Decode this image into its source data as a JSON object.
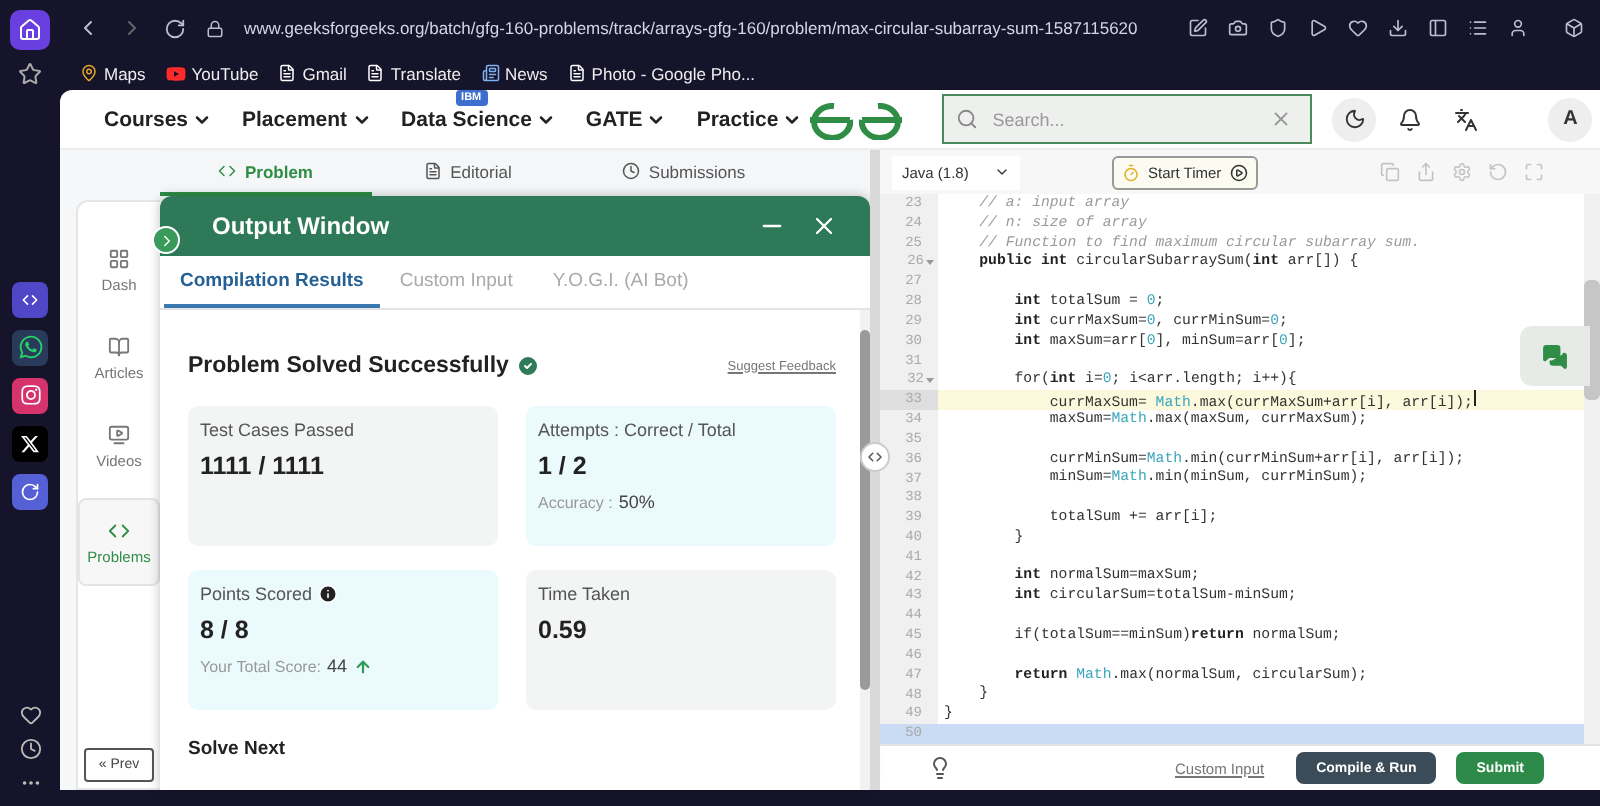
{
  "browser": {
    "url": "www.geeksforgeeks.org/batch/gfg-160-problems/track/arrays-gfg-160/problem/max-circular-subarray-sum-1587115620"
  },
  "bookmarks": [
    {
      "label": "Maps"
    },
    {
      "label": "YouTube"
    },
    {
      "label": "Gmail"
    },
    {
      "label": "Translate"
    },
    {
      "label": "News"
    },
    {
      "label": "Photo - Google Pho..."
    }
  ],
  "nav": {
    "items": [
      {
        "label": "Courses"
      },
      {
        "label": "Placement"
      },
      {
        "label": "Data Science",
        "badge": "IBM"
      },
      {
        "label": "GATE"
      },
      {
        "label": "Practice"
      }
    ]
  },
  "search": {
    "placeholder": "Search..."
  },
  "avatar": "A",
  "problem_tabs": [
    {
      "label": "Problem",
      "selected": true
    },
    {
      "label": "Editorial",
      "selected": false
    },
    {
      "label": "Submissions",
      "selected": false
    }
  ],
  "side_nav": [
    {
      "label": "Dash",
      "selected": false
    },
    {
      "label": "Articles",
      "selected": false
    },
    {
      "label": "Videos",
      "selected": false
    },
    {
      "label": "Problems",
      "selected": true
    }
  ],
  "prev_button": "« Prev",
  "output_window": {
    "title": "Output Window",
    "tabs": [
      {
        "label": "Compilation Results",
        "selected": true
      },
      {
        "label": "Custom Input",
        "selected": false
      },
      {
        "label": "Y.O.G.I. (AI Bot)",
        "selected": false
      }
    ],
    "status": "Problem Solved Successfully",
    "feedback_link": "Suggest Feedback",
    "cards": [
      {
        "label": "Test Cases Passed",
        "value": "1111 / 1111",
        "info": false
      },
      {
        "label": "Attempts : Correct / Total",
        "value": "1 / 2",
        "note_label": "Accuracy :",
        "note_value": "50%",
        "info": false,
        "rising": false
      },
      {
        "label": "Points Scored",
        "value": "8 / 8",
        "note_label": "Your Total Score:",
        "note_value": "44",
        "info": true,
        "rising": true
      },
      {
        "label": "Time Taken",
        "value": "0.59",
        "info": false
      }
    ],
    "solve_next": "Solve Next"
  },
  "editor": {
    "language": "Java (1.8)",
    "timer_button": "Start Timer",
    "lines": [
      {
        "n": "23",
        "fold": false,
        "current": false,
        "selected": false,
        "tokens": [
          {
            "kind": "comment",
            "t": "    // a: input array"
          }
        ]
      },
      {
        "n": "24",
        "fold": false,
        "current": false,
        "selected": false,
        "tokens": [
          {
            "kind": "comment",
            "t": "    // n: size of array"
          }
        ]
      },
      {
        "n": "25",
        "fold": false,
        "current": false,
        "selected": false,
        "tokens": [
          {
            "kind": "comment",
            "t": "    // Function to find maximum circular subarray sum."
          }
        ]
      },
      {
        "n": "26",
        "fold": true,
        "current": false,
        "selected": false,
        "tokens": [
          {
            "kind": "keyword",
            "t": "    public int"
          },
          {
            "kind": "plain",
            "t": " circularSubarraySum("
          },
          {
            "kind": "keyword",
            "t": "int"
          },
          {
            "kind": "plain",
            "t": " arr[]) {"
          }
        ]
      },
      {
        "n": "27",
        "fold": false,
        "current": false,
        "selected": false
      },
      {
        "n": "28",
        "fold": false,
        "current": false,
        "selected": false,
        "tokens": [
          {
            "kind": "keyword",
            "t": "        int"
          },
          {
            "kind": "plain",
            "t": " totalSum = "
          },
          {
            "kind": "number",
            "t": "0"
          },
          {
            "kind": "plain",
            "t": ";"
          }
        ]
      },
      {
        "n": "29",
        "fold": false,
        "current": false,
        "selected": false,
        "tokens": [
          {
            "kind": "keyword",
            "t": "        int"
          },
          {
            "kind": "plain",
            "t": " currMaxSum="
          },
          {
            "kind": "number",
            "t": "0"
          },
          {
            "kind": "plain",
            "t": ", currMinSum="
          },
          {
            "kind": "number",
            "t": "0"
          },
          {
            "kind": "plain",
            "t": ";"
          }
        ]
      },
      {
        "n": "30",
        "fold": false,
        "current": false,
        "selected": false,
        "tokens": [
          {
            "kind": "keyword",
            "t": "        int"
          },
          {
            "kind": "plain",
            "t": " maxSum=arr["
          },
          {
            "kind": "number",
            "t": "0"
          },
          {
            "kind": "plain",
            "t": "], minSum=arr["
          },
          {
            "kind": "number",
            "t": "0"
          },
          {
            "kind": "plain",
            "t": "];"
          }
        ]
      },
      {
        "n": "31",
        "fold": false,
        "current": false,
        "selected": false
      },
      {
        "n": "32",
        "fold": true,
        "current": false,
        "selected": false,
        "tokens": [
          {
            "kind": "plain",
            "t": "        for("
          },
          {
            "kind": "keyword",
            "t": "int"
          },
          {
            "kind": "plain",
            "t": " i="
          },
          {
            "kind": "number",
            "t": "0"
          },
          {
            "kind": "plain",
            "t": "; i<arr.length; i++){"
          }
        ]
      },
      {
        "n": "33",
        "fold": false,
        "current": true,
        "selected": false,
        "tokens": [
          {
            "kind": "plain",
            "t": "            currMaxSum= "
          },
          {
            "kind": "builtin",
            "t": "Math"
          },
          {
            "kind": "plain",
            "t": ".max(currMaxSum+arr[i], arr[i]);"
          }
        ]
      },
      {
        "n": "34",
        "fold": false,
        "current": false,
        "selected": false,
        "tokens": [
          {
            "kind": "plain",
            "t": "            maxSum="
          },
          {
            "kind": "builtin",
            "t": "Math"
          },
          {
            "kind": "plain",
            "t": ".max(maxSum, currMaxSum);"
          }
        ]
      },
      {
        "n": "35",
        "fold": false,
        "current": false,
        "selected": false
      },
      {
        "n": "36",
        "fold": false,
        "current": false,
        "selected": false,
        "tokens": [
          {
            "kind": "plain",
            "t": "            currMinSum="
          },
          {
            "kind": "builtin",
            "t": "Math"
          },
          {
            "kind": "plain",
            "t": ".min(currMinSum+arr[i], arr[i]);"
          }
        ]
      },
      {
        "n": "37",
        "fold": false,
        "current": false,
        "selected": false,
        "tokens": [
          {
            "kind": "plain",
            "t": "            minSum="
          },
          {
            "kind": "builtin",
            "t": "Math"
          },
          {
            "kind": "plain",
            "t": ".min(minSum, currMinSum);"
          }
        ]
      },
      {
        "n": "38",
        "fold": false,
        "current": false,
        "selected": false
      },
      {
        "n": "39",
        "fold": false,
        "current": false,
        "selected": false,
        "tokens": [
          {
            "kind": "plain",
            "t": "            totalSum += arr[i];"
          }
        ]
      },
      {
        "n": "40",
        "fold": false,
        "current": false,
        "selected": false,
        "tokens": [
          {
            "kind": "plain",
            "t": "        }"
          }
        ]
      },
      {
        "n": "41",
        "fold": false,
        "current": false,
        "selected": false
      },
      {
        "n": "42",
        "fold": false,
        "current": false,
        "selected": false,
        "tokens": [
          {
            "kind": "keyword",
            "t": "        int"
          },
          {
            "kind": "plain",
            "t": " normalSum=maxSum;"
          }
        ]
      },
      {
        "n": "43",
        "fold": false,
        "current": false,
        "selected": false,
        "tokens": [
          {
            "kind": "keyword",
            "t": "        int"
          },
          {
            "kind": "plain",
            "t": " circularSum=totalSum-minSum;"
          }
        ]
      },
      {
        "n": "44",
        "fold": false,
        "current": false,
        "selected": false
      },
      {
        "n": "45",
        "fold": false,
        "current": false,
        "selected": false,
        "tokens": [
          {
            "kind": "plain",
            "t": "        if(totalSum==minSum)"
          },
          {
            "kind": "keyword",
            "t": "return"
          },
          {
            "kind": "plain",
            "t": " normalSum;"
          }
        ]
      },
      {
        "n": "46",
        "fold": false,
        "current": false,
        "selected": false
      },
      {
        "n": "47",
        "fold": false,
        "current": false,
        "selected": false,
        "tokens": [
          {
            "kind": "keyword",
            "t": "        return "
          },
          {
            "kind": "builtin",
            "t": "Math"
          },
          {
            "kind": "plain",
            "t": ".max(normalSum, circularSum);"
          }
        ]
      },
      {
        "n": "48",
        "fold": false,
        "current": false,
        "selected": false,
        "tokens": [
          {
            "kind": "plain",
            "t": "    }"
          }
        ]
      },
      {
        "n": "49",
        "fold": false,
        "current": false,
        "selected": false,
        "tokens": [
          {
            "kind": "plain",
            "t": "}"
          }
        ]
      },
      {
        "n": "50",
        "fold": false,
        "current": false,
        "selected": true
      }
    ]
  },
  "footer": {
    "custom_input": "Custom Input",
    "compile_button": "Compile & Run",
    "submit_button": "Submit"
  }
}
